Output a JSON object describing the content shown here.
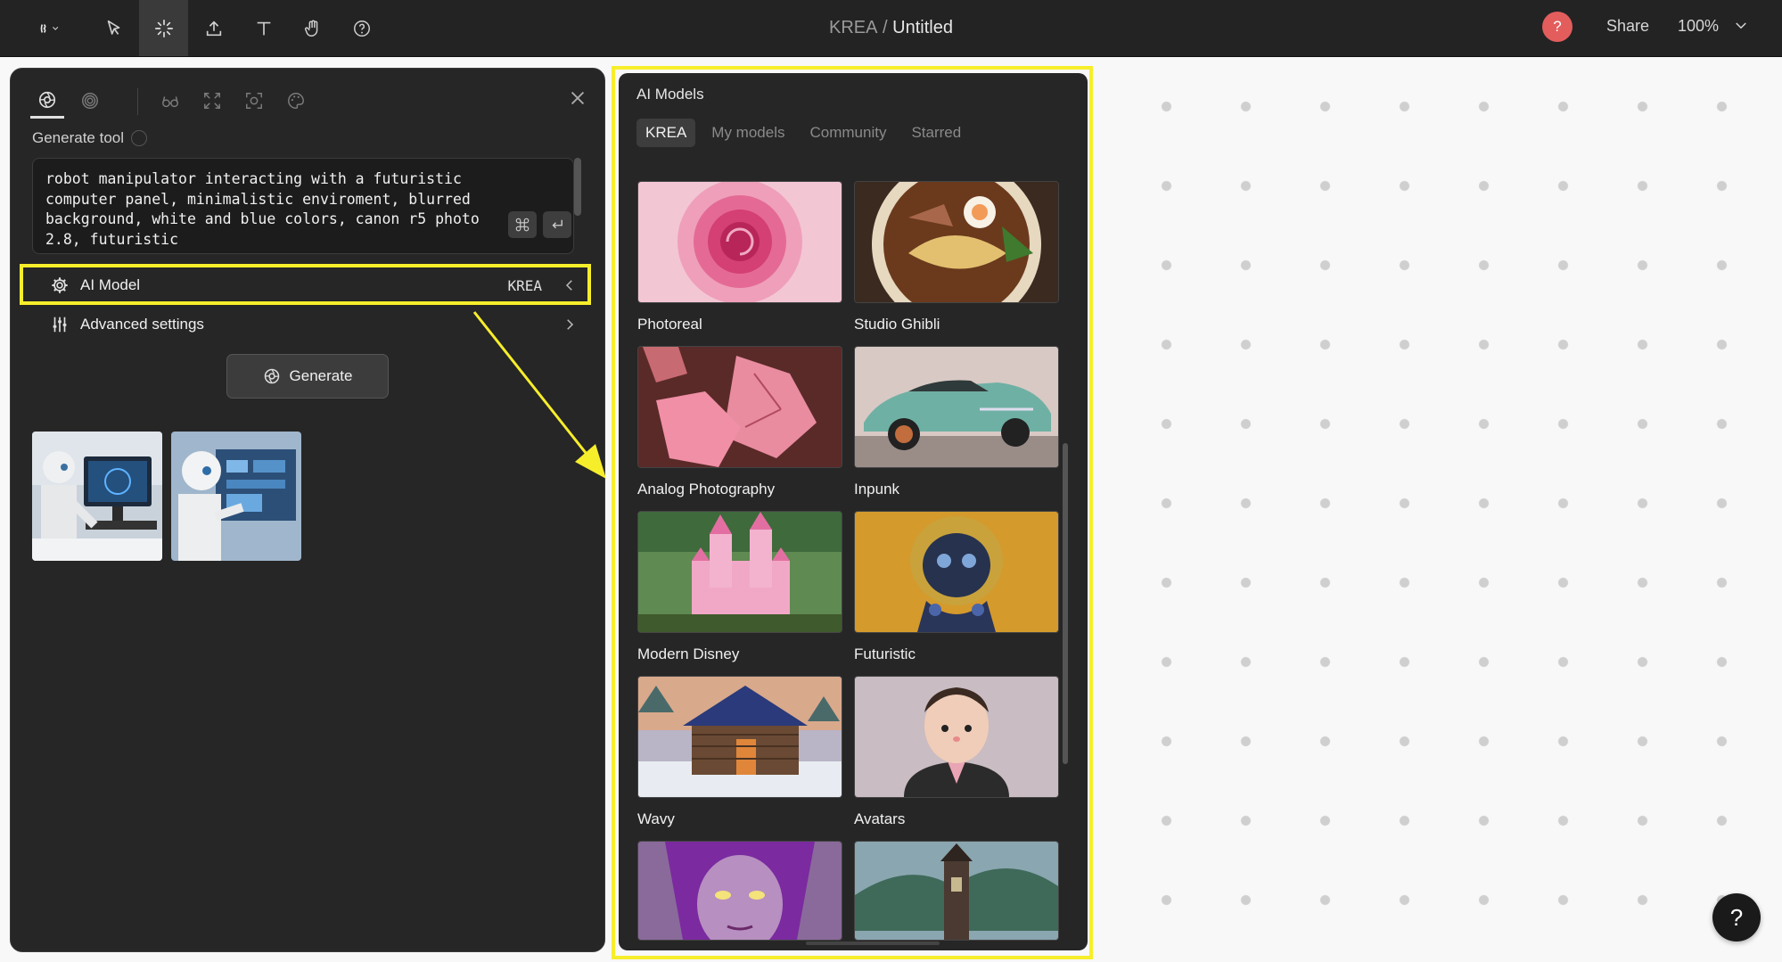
{
  "topbar": {
    "breadcrumb_app": "KREA",
    "breadcrumb_sep": " / ",
    "document_title": "Untitled",
    "avatar_label": "?",
    "share_label": "Share",
    "zoom": "100%",
    "tools": [
      "krea-logo-icon",
      "select-arrow-icon",
      "generate-sparkle-icon",
      "upload-icon",
      "text-icon",
      "hand-icon",
      "help-circle-icon"
    ]
  },
  "generate_panel": {
    "label": "Generate tool",
    "prompt": "robot manipulator interacting with a futuristic\ncomputer panel, minimalistic enviroment, blurred\nbackground, white and blue colors, canon r5 photo\n2.8, futuristic",
    "ai_model_label": "AI Model",
    "ai_model_value": "KREA",
    "advanced_label": "Advanced settings",
    "generate_label": "Generate"
  },
  "models_panel": {
    "title": "AI Models",
    "tabs": [
      "KREA",
      "My models",
      "Community",
      "Starred"
    ],
    "active_tab": "KREA",
    "cards": [
      "Photoreal",
      "Studio Ghibli",
      "Analog Photography",
      "Inpunk",
      "Modern Disney",
      "Futuristic",
      "Wavy",
      "Avatars"
    ]
  },
  "help_label": "?",
  "colors": {
    "highlight": "#f7ee2b",
    "panel": "#262626",
    "topbar": "#232323",
    "avatar": "#e35d5d"
  }
}
